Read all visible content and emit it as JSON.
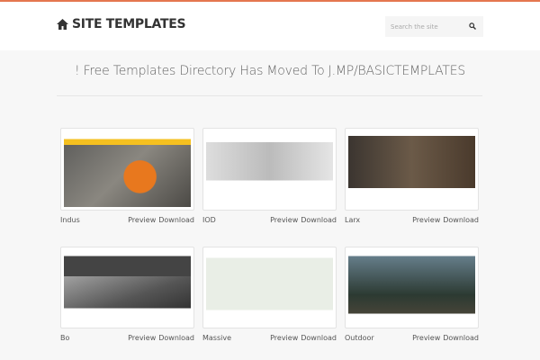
{
  "header": {
    "logo": "SITE TEMPLATES",
    "search_placeholder": "Search the site"
  },
  "notice": "! Free Templates Directory Has Moved To J.MP/BASICTEMPLATES",
  "templates": [
    {
      "name": "Indus",
      "preview": "Preview",
      "download": "Download"
    },
    {
      "name": "IOD",
      "preview": "Preview",
      "download": "Download"
    },
    {
      "name": "Larx",
      "preview": "Preview",
      "download": "Download"
    },
    {
      "name": "Bo",
      "preview": "Preview",
      "download": "Download"
    },
    {
      "name": "Massive",
      "preview": "Preview",
      "download": "Download"
    },
    {
      "name": "Outdoor",
      "preview": "Preview",
      "download": "Download"
    }
  ],
  "colors": {
    "accent": "#e5774f",
    "background": "#f7f7f7"
  }
}
